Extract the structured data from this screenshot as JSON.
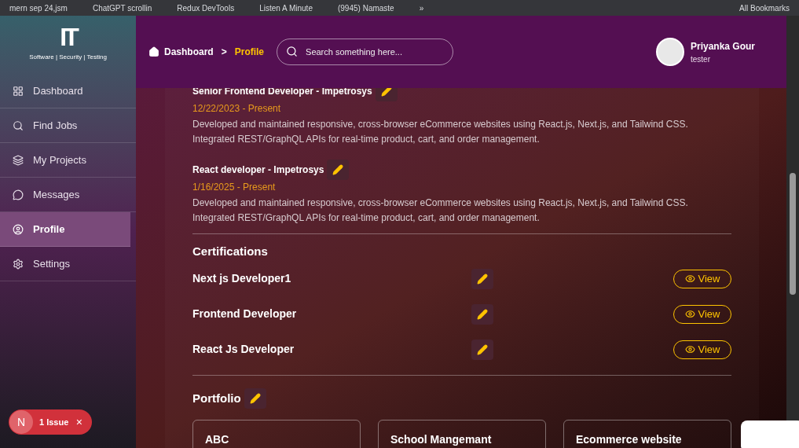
{
  "bookmarks_bar": {
    "items": [
      "mern sep 24,jsm",
      "ChatGPT scrollin",
      "Redux DevTools",
      "Listen A Minute",
      "(9945) Namaste",
      "»",
      "All Bookmarks"
    ]
  },
  "sidebar": {
    "logo": {
      "mark": "IT",
      "tagline": "Software | Security | Testing"
    },
    "items": [
      {
        "label": "Dashboard",
        "selected": false
      },
      {
        "label": "Find Jobs",
        "selected": false
      },
      {
        "label": "My Projects",
        "selected": false
      },
      {
        "label": "Messages",
        "selected": false
      },
      {
        "label": "Profile",
        "selected": true
      },
      {
        "label": "Settings",
        "selected": false
      }
    ]
  },
  "header": {
    "breadcrumb": [
      "Dashboard",
      ">",
      "Profile"
    ],
    "search": {
      "placeholder": "Search something here..."
    },
    "user": {
      "name": "Priyanka Gour",
      "role": "tester"
    }
  },
  "experience": [
    {
      "title": "Senior Frontend Developer - Impetrosys",
      "dates": "12/22/2023 - Present",
      "description": "Developed and maintained responsive, cross-browser eCommerce websites using React.js, Next.js, and Tailwind CSS. Integrated REST/GraphQL APIs for real-time product, cart, and order management."
    },
    {
      "title": "React developer - Impetrosys",
      "dates": "1/16/2025 - Present",
      "description": "Developed and maintained responsive, cross-browser eCommerce websites using React.js, Next.js, and Tailwind CSS. Integrated REST/GraphQL APIs for real-time product, cart, and order management."
    }
  ],
  "certifications": {
    "title": "Certifications",
    "items": [
      {
        "name": "Next js Developer1",
        "action": "View"
      },
      {
        "name": "Frontend Developer",
        "action": "View"
      },
      {
        "name": "React Js Developer",
        "action": "View"
      }
    ]
  },
  "portfolio": {
    "title": "Portfolio",
    "items": [
      "ABC",
      "School Mangemant",
      "Ecommerce website"
    ]
  },
  "issue_badge": {
    "letter": "N",
    "label": "1 Issue",
    "close": "×"
  }
}
